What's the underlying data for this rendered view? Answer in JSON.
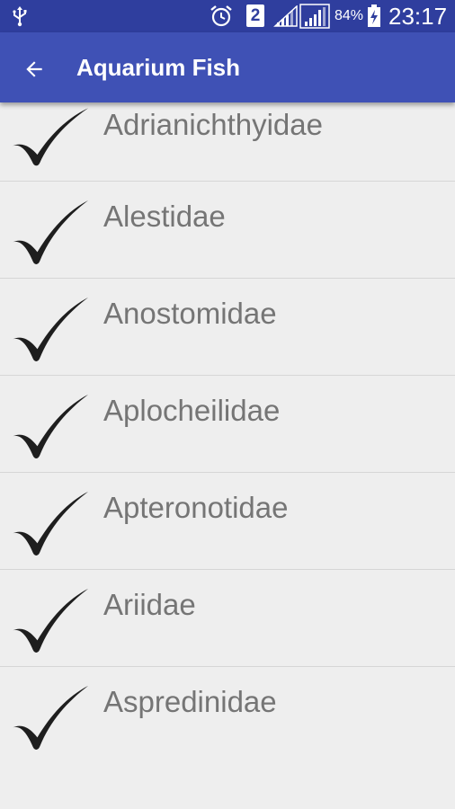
{
  "status_bar": {
    "sim_slot": "2",
    "battery_percent": "84%",
    "time": "23:17"
  },
  "app_bar": {
    "title": "Aquarium Fish"
  },
  "families": [
    {
      "label": "Adrianichthyidae"
    },
    {
      "label": "Alestidae"
    },
    {
      "label": "Anostomidae"
    },
    {
      "label": "Aplocheilidae"
    },
    {
      "label": "Apteronotidae"
    },
    {
      "label": "Ariidae"
    },
    {
      "label": "Aspredinidae"
    }
  ],
  "colors": {
    "status_bar": "#2f3e9e",
    "app_bar": "#3f51b5",
    "background": "#eeeeee",
    "item_text": "#757575",
    "divider": "#d6d6d6",
    "checkmark": "#1e1e1e"
  },
  "icons": {
    "usb": "usb-icon",
    "alarm": "alarm-icon",
    "sim": "sim-icon",
    "signal": "signal-icon",
    "battery": "battery-charging-icon",
    "back": "back-arrow-icon",
    "check": "checkmark-icon"
  }
}
